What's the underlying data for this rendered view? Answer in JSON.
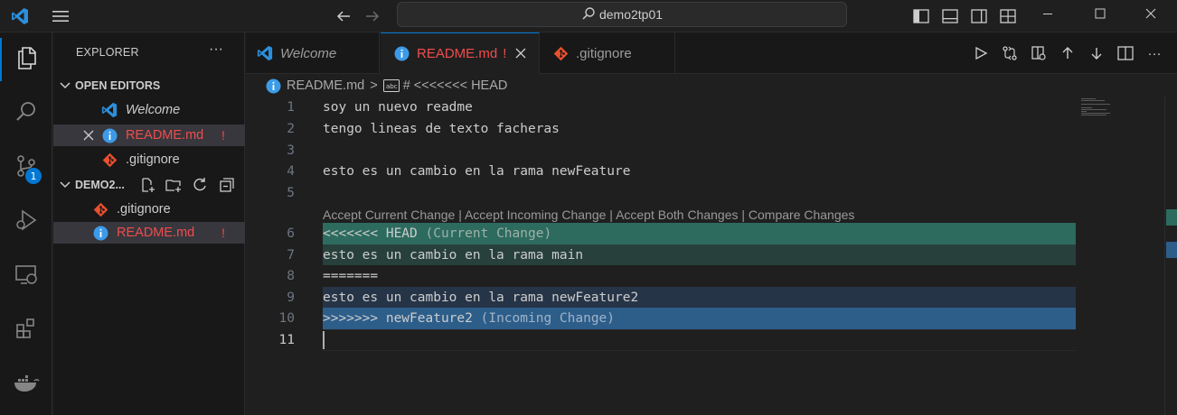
{
  "window": {
    "search_text": "demo2tp01"
  },
  "activity": {
    "scm_badge": "1"
  },
  "explorer": {
    "title": "EXPLORER",
    "more": "···",
    "open_editors_header": "OPEN EDITORS",
    "open_editors": [
      {
        "name": "Welcome",
        "italic": true
      },
      {
        "name": "README.md",
        "modified": "!"
      },
      {
        "name": ".gitignore"
      }
    ],
    "folder_header": "DEMO2...",
    "files": [
      {
        "name": ".gitignore"
      },
      {
        "name": "README.md",
        "modified": "!"
      }
    ]
  },
  "tabs": [
    {
      "label": "Welcome"
    },
    {
      "label": "README.md",
      "modified": "!"
    },
    {
      "label": ".gitignore"
    }
  ],
  "breadcrumb": {
    "file": "README.md",
    "separator": ">",
    "symbol": "# <<<<<<< HEAD"
  },
  "editor": {
    "lines": [
      {
        "num": "1",
        "text": "soy un nuevo readme"
      },
      {
        "num": "2",
        "text": "tengo lineas de texto facheras"
      },
      {
        "num": "3",
        "text": ""
      },
      {
        "num": "4",
        "text": "esto es un cambio en la rama newFeature"
      },
      {
        "num": "5",
        "text": ""
      },
      {
        "num": "6",
        "text": "<<<<<<< HEAD",
        "hint": "(Current Change)"
      },
      {
        "num": "7",
        "text": "esto es un cambio en la rama main"
      },
      {
        "num": "8",
        "text": "======="
      },
      {
        "num": "9",
        "text": "esto es un cambio en la rama newFeature2"
      },
      {
        "num": "10",
        "text": ">>>>>>> newFeature2",
        "hint": "(Incoming Change)"
      },
      {
        "num": "11",
        "text": ""
      }
    ],
    "codelens": {
      "accept_current": "Accept Current Change",
      "accept_incoming": "Accept Incoming Change",
      "accept_both": "Accept Both Changes",
      "compare": "Compare Changes",
      "sep": " | "
    }
  },
  "colors": {
    "current_header": "#2d6b5e",
    "current_body": "#27403b",
    "incoming_body": "#263447",
    "incoming_header": "#2d5e8a",
    "accent": "#0078d4",
    "modified": "#f14c4c"
  }
}
